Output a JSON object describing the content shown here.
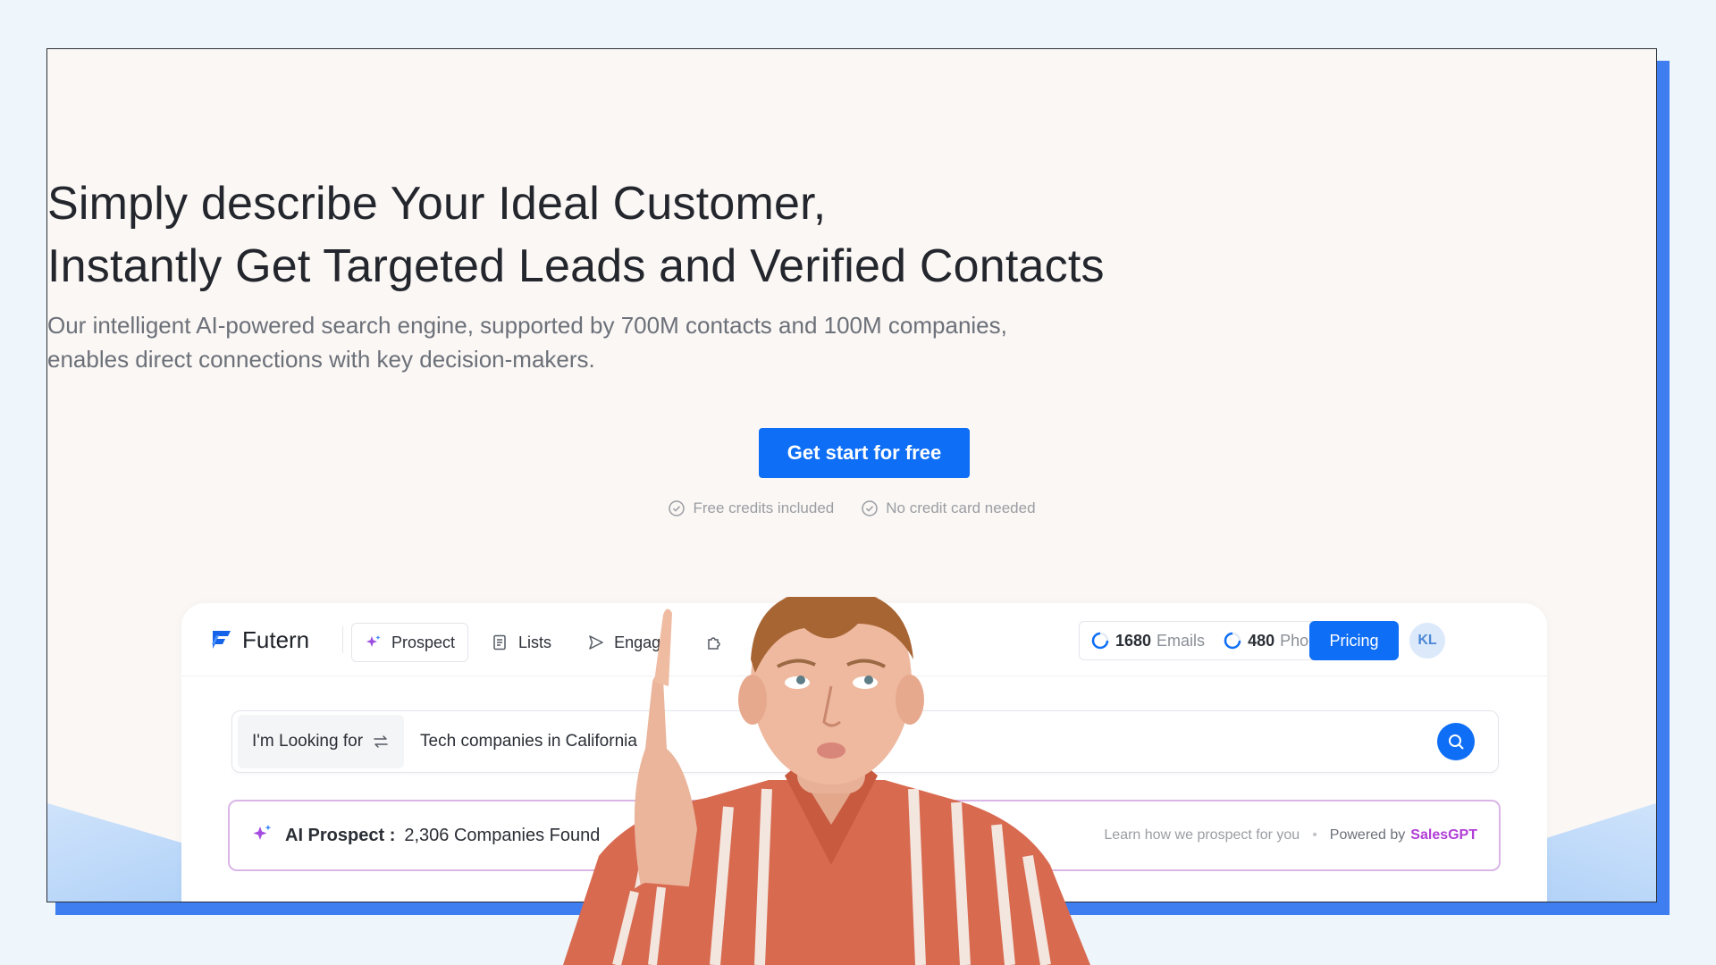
{
  "hero": {
    "headline_line1": "Simply describe Your Ideal Customer,",
    "headline_line2": "Instantly Get Targeted Leads and Verified Contacts",
    "sub_line1": "Our intelligent AI-powered search engine, supported by 700M contacts and 100M companies,",
    "sub_line2": "enables direct connections with key decision-makers.",
    "cta_label": "Get start for free",
    "perks": [
      "Free credits included",
      "No credit card needed"
    ]
  },
  "app": {
    "logo": "Futern",
    "nav": [
      {
        "label": "Prospect",
        "icon": "sparkle-icon",
        "active": true
      },
      {
        "label": "Lists",
        "icon": "list-icon",
        "active": false
      },
      {
        "label": "Engage",
        "icon": "send-icon",
        "active": false
      }
    ],
    "credits": {
      "emails_count": "1680",
      "emails_label": "Emails",
      "phones_count": "480",
      "phones_label": "Phones"
    },
    "pricing_label": "Pricing",
    "avatar_initials": "KL",
    "search": {
      "mode_label": "I'm Looking for",
      "query": "Tech companies in California"
    },
    "ai_prospect": {
      "label": "AI Prospect :",
      "result": "2,306 Companies Found",
      "learn_link": "Learn how we prospect for you",
      "powered_by": "Powered by",
      "brand": "SalesGPT"
    }
  },
  "colors": {
    "accent": "#0e6ef5",
    "frame_shadow": "#3f7ef0",
    "ai_border": "#d9b6e6",
    "brand_purple": "#b13ed6"
  }
}
